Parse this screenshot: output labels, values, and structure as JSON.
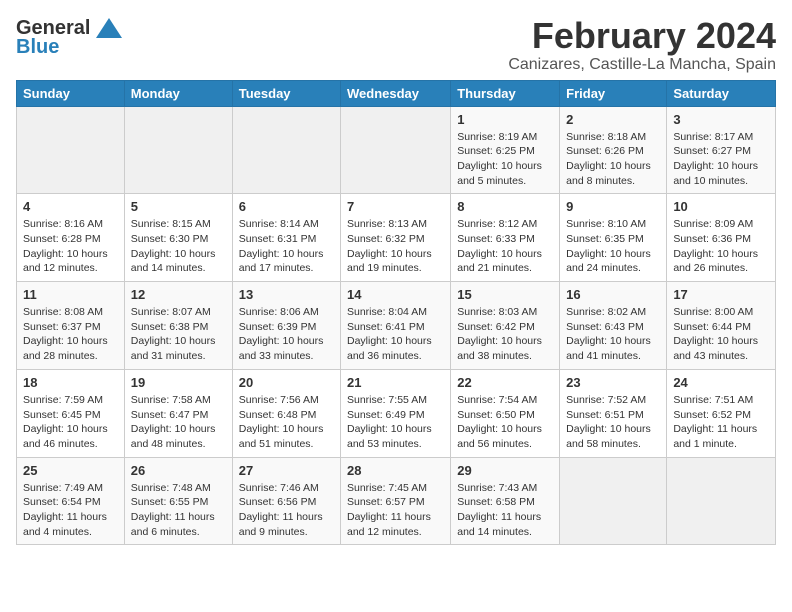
{
  "logo": {
    "general": "General",
    "blue": "Blue"
  },
  "title": "February 2024",
  "subtitle": "Canizares, Castille-La Mancha, Spain",
  "days_header": [
    "Sunday",
    "Monday",
    "Tuesday",
    "Wednesday",
    "Thursday",
    "Friday",
    "Saturday"
  ],
  "weeks": [
    [
      {
        "day": "",
        "info": ""
      },
      {
        "day": "",
        "info": ""
      },
      {
        "day": "",
        "info": ""
      },
      {
        "day": "",
        "info": ""
      },
      {
        "day": "1",
        "info": "Sunrise: 8:19 AM\nSunset: 6:25 PM\nDaylight: 10 hours\nand 5 minutes."
      },
      {
        "day": "2",
        "info": "Sunrise: 8:18 AM\nSunset: 6:26 PM\nDaylight: 10 hours\nand 8 minutes."
      },
      {
        "day": "3",
        "info": "Sunrise: 8:17 AM\nSunset: 6:27 PM\nDaylight: 10 hours\nand 10 minutes."
      }
    ],
    [
      {
        "day": "4",
        "info": "Sunrise: 8:16 AM\nSunset: 6:28 PM\nDaylight: 10 hours\nand 12 minutes."
      },
      {
        "day": "5",
        "info": "Sunrise: 8:15 AM\nSunset: 6:30 PM\nDaylight: 10 hours\nand 14 minutes."
      },
      {
        "day": "6",
        "info": "Sunrise: 8:14 AM\nSunset: 6:31 PM\nDaylight: 10 hours\nand 17 minutes."
      },
      {
        "day": "7",
        "info": "Sunrise: 8:13 AM\nSunset: 6:32 PM\nDaylight: 10 hours\nand 19 minutes."
      },
      {
        "day": "8",
        "info": "Sunrise: 8:12 AM\nSunset: 6:33 PM\nDaylight: 10 hours\nand 21 minutes."
      },
      {
        "day": "9",
        "info": "Sunrise: 8:10 AM\nSunset: 6:35 PM\nDaylight: 10 hours\nand 24 minutes."
      },
      {
        "day": "10",
        "info": "Sunrise: 8:09 AM\nSunset: 6:36 PM\nDaylight: 10 hours\nand 26 minutes."
      }
    ],
    [
      {
        "day": "11",
        "info": "Sunrise: 8:08 AM\nSunset: 6:37 PM\nDaylight: 10 hours\nand 28 minutes."
      },
      {
        "day": "12",
        "info": "Sunrise: 8:07 AM\nSunset: 6:38 PM\nDaylight: 10 hours\nand 31 minutes."
      },
      {
        "day": "13",
        "info": "Sunrise: 8:06 AM\nSunset: 6:39 PM\nDaylight: 10 hours\nand 33 minutes."
      },
      {
        "day": "14",
        "info": "Sunrise: 8:04 AM\nSunset: 6:41 PM\nDaylight: 10 hours\nand 36 minutes."
      },
      {
        "day": "15",
        "info": "Sunrise: 8:03 AM\nSunset: 6:42 PM\nDaylight: 10 hours\nand 38 minutes."
      },
      {
        "day": "16",
        "info": "Sunrise: 8:02 AM\nSunset: 6:43 PM\nDaylight: 10 hours\nand 41 minutes."
      },
      {
        "day": "17",
        "info": "Sunrise: 8:00 AM\nSunset: 6:44 PM\nDaylight: 10 hours\nand 43 minutes."
      }
    ],
    [
      {
        "day": "18",
        "info": "Sunrise: 7:59 AM\nSunset: 6:45 PM\nDaylight: 10 hours\nand 46 minutes."
      },
      {
        "day": "19",
        "info": "Sunrise: 7:58 AM\nSunset: 6:47 PM\nDaylight: 10 hours\nand 48 minutes."
      },
      {
        "day": "20",
        "info": "Sunrise: 7:56 AM\nSunset: 6:48 PM\nDaylight: 10 hours\nand 51 minutes."
      },
      {
        "day": "21",
        "info": "Sunrise: 7:55 AM\nSunset: 6:49 PM\nDaylight: 10 hours\nand 53 minutes."
      },
      {
        "day": "22",
        "info": "Sunrise: 7:54 AM\nSunset: 6:50 PM\nDaylight: 10 hours\nand 56 minutes."
      },
      {
        "day": "23",
        "info": "Sunrise: 7:52 AM\nSunset: 6:51 PM\nDaylight: 10 hours\nand 58 minutes."
      },
      {
        "day": "24",
        "info": "Sunrise: 7:51 AM\nSunset: 6:52 PM\nDaylight: 11 hours\nand 1 minute."
      }
    ],
    [
      {
        "day": "25",
        "info": "Sunrise: 7:49 AM\nSunset: 6:54 PM\nDaylight: 11 hours\nand 4 minutes."
      },
      {
        "day": "26",
        "info": "Sunrise: 7:48 AM\nSunset: 6:55 PM\nDaylight: 11 hours\nand 6 minutes."
      },
      {
        "day": "27",
        "info": "Sunrise: 7:46 AM\nSunset: 6:56 PM\nDaylight: 11 hours\nand 9 minutes."
      },
      {
        "day": "28",
        "info": "Sunrise: 7:45 AM\nSunset: 6:57 PM\nDaylight: 11 hours\nand 12 minutes."
      },
      {
        "day": "29",
        "info": "Sunrise: 7:43 AM\nSunset: 6:58 PM\nDaylight: 11 hours\nand 14 minutes."
      },
      {
        "day": "",
        "info": ""
      },
      {
        "day": "",
        "info": ""
      }
    ]
  ]
}
